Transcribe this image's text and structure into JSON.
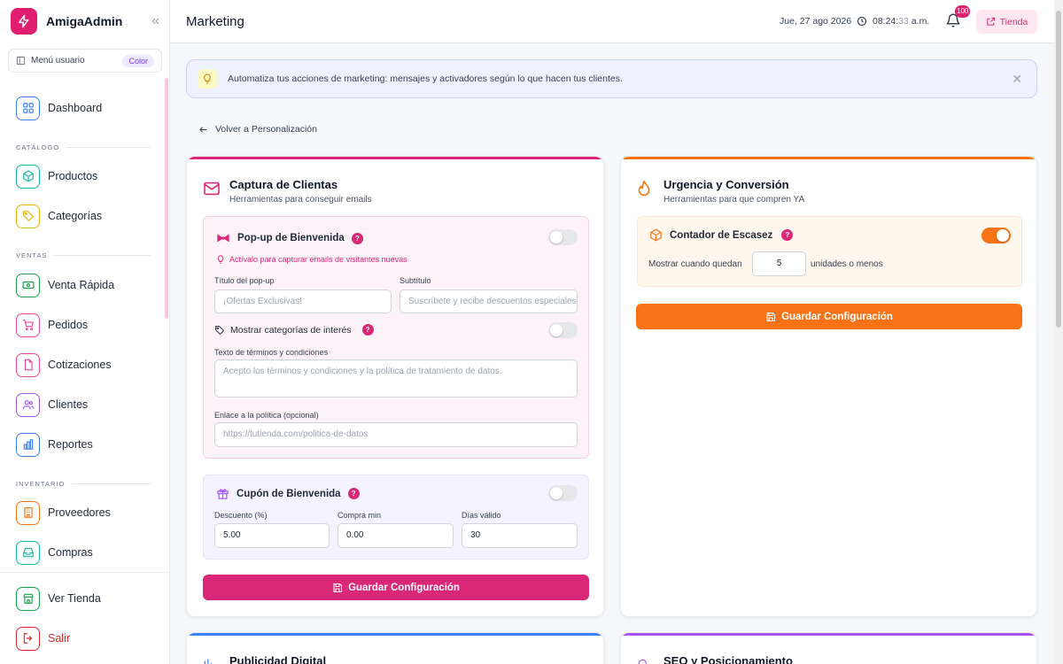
{
  "brand": {
    "name": "AmigaAdmin",
    "collapse_icon": "double-chevron-left-icon",
    "accent": "#e11d6f"
  },
  "menu_user": {
    "label": "Menú usuario",
    "badge": "Color"
  },
  "nav": {
    "dashboard": "Dashboard",
    "catalog_section": "CATÁLOGO",
    "products": "Productos",
    "categories": "Categorías",
    "sales_section": "VENTAS",
    "quick_sale": "Venta Rápida",
    "orders": "Pedidos",
    "quotes": "Cotizaciones",
    "clients": "Clientes",
    "reports": "Reportes",
    "inventory_section": "INVENTARIO",
    "suppliers": "Proveedores",
    "purchases": "Compras",
    "view_store": "Ver Tienda",
    "logout": "Salir"
  },
  "header": {
    "title": "Marketing",
    "date": "Jue, 27 ago 2026",
    "time_main": "08:24:",
    "time_sec": "33",
    "time_suffix": " a.m.",
    "notifications": "100",
    "store_button": "Tienda"
  },
  "info": {
    "text": "Automatiza tus acciones de marketing: mensajes y activadores según lo que hacen tus clientes."
  },
  "back_link": "Volver a Personalización",
  "capture": {
    "title": "Captura de Clientas",
    "subtitle": "Herramientas para conseguir emails",
    "popup": {
      "title": "Pop-up de Bienvenida",
      "hint": "Actívalo para capturar emails de visitantes nuevas",
      "title_label": "Título del pop-up",
      "title_placeholder": "¡Ofertas Exclusivas!",
      "subtitle_label": "Subtítulo",
      "subtitle_placeholder": "Suscríbete y recibe descuentos especiales",
      "categories_label": "Mostrar categorías de interés",
      "terms_label": "Texto de términos y condiciones",
      "terms_placeholder": "Acepto los términos y condiciones y la política de tratamiento de datos.",
      "policy_label": "Enlace a la política (opcional)",
      "policy_placeholder": "https://tutienda.com/politica-de-datos",
      "enabled": false,
      "categories_enabled": false
    },
    "coupon": {
      "title": "Cupón de Bienvenida",
      "discount_label": "Descuento (%)",
      "discount_value": "5.00",
      "min_label": "Compra min",
      "min_value": "0.00",
      "days_label": "Días válido",
      "days_value": "30",
      "enabled": false
    },
    "save_label": "Guardar Configuración",
    "color": "#db2777"
  },
  "urgency": {
    "title": "Urgencia y Conversión",
    "subtitle": "Herramientas para que compren YA",
    "scarcity": {
      "title": "Contador de Escasez",
      "show_when": "Mostrar cuando quedan",
      "units_value": "5",
      "units_suffix": "unidades o menos",
      "enabled": true
    },
    "save_label": "Guardar Configuración",
    "color": "#f97316"
  },
  "bottom_cards": {
    "ads_title": "Publicidad Digital",
    "seo_title": "SEO y Posicionamiento"
  }
}
